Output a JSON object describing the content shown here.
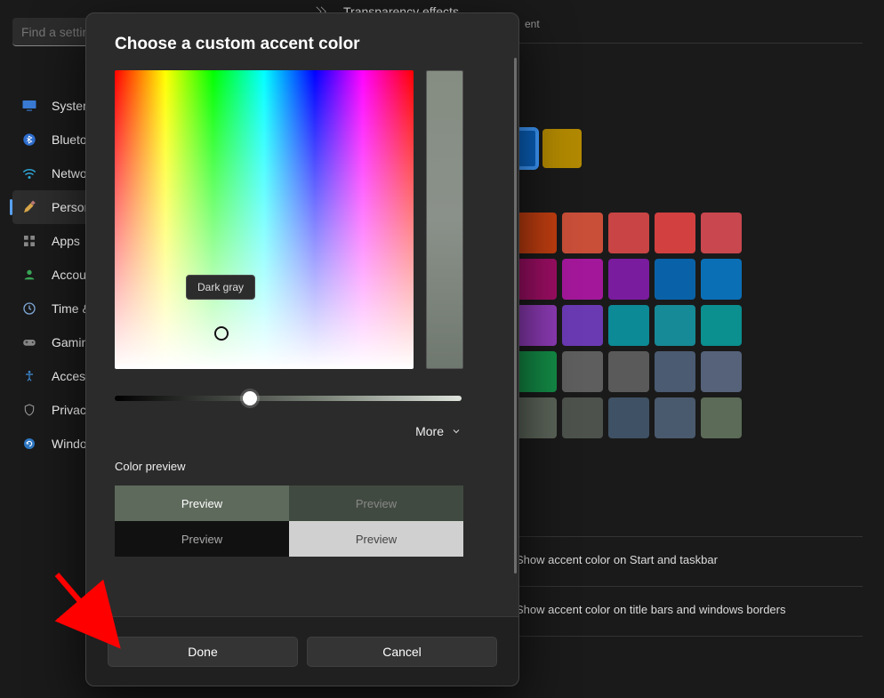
{
  "search": {
    "placeholder": "Find a setting"
  },
  "nav": {
    "items": [
      {
        "label": "System"
      },
      {
        "label": "Bluetooth & devices"
      },
      {
        "label": "Network & internet"
      },
      {
        "label": "Personalization"
      },
      {
        "label": "Apps"
      },
      {
        "label": "Accounts"
      },
      {
        "label": "Time & language"
      },
      {
        "label": "Gaming"
      },
      {
        "label": "Accessibility"
      },
      {
        "label": "Privacy & security"
      },
      {
        "label": "Windows Update"
      }
    ],
    "active_index": 3
  },
  "main": {
    "transparency_title": "Transparency effects",
    "transparency_sub_partial": "ent",
    "recent_swatches": [
      "#0a63c0",
      "#b28900"
    ],
    "palette_rows": [
      [
        "#bf3d10",
        "#c94f39",
        "#c94444",
        "#d24040",
        "#c9474f"
      ],
      [
        "#9b0e63",
        "#a3189a",
        "#7a1c9e",
        "#0962a8",
        "#0b6fb6"
      ],
      [
        "#8b3ab3",
        "#6a3ab3",
        "#0c8a96",
        "#168a96",
        "#0b8f8f"
      ],
      [
        "#138a45",
        "#5e5e5e",
        "#5a5a5a",
        "#4a5b72",
        "#55627a"
      ],
      [
        "#5a6358",
        "#4d524d",
        "#3f5164",
        "#4a5a6e",
        "#5b6b57"
      ]
    ],
    "taskbar_label": "Show accent color on Start and taskbar",
    "borders_label": "Show accent color on title bars and windows borders"
  },
  "dialog": {
    "title": "Choose a custom accent color",
    "tooltip": "Dark gray",
    "more": "More",
    "preview_label": "Color preview",
    "preview_cells": [
      "Preview",
      "Preview",
      "Preview",
      "Preview"
    ],
    "done": "Done",
    "cancel": "Cancel"
  }
}
